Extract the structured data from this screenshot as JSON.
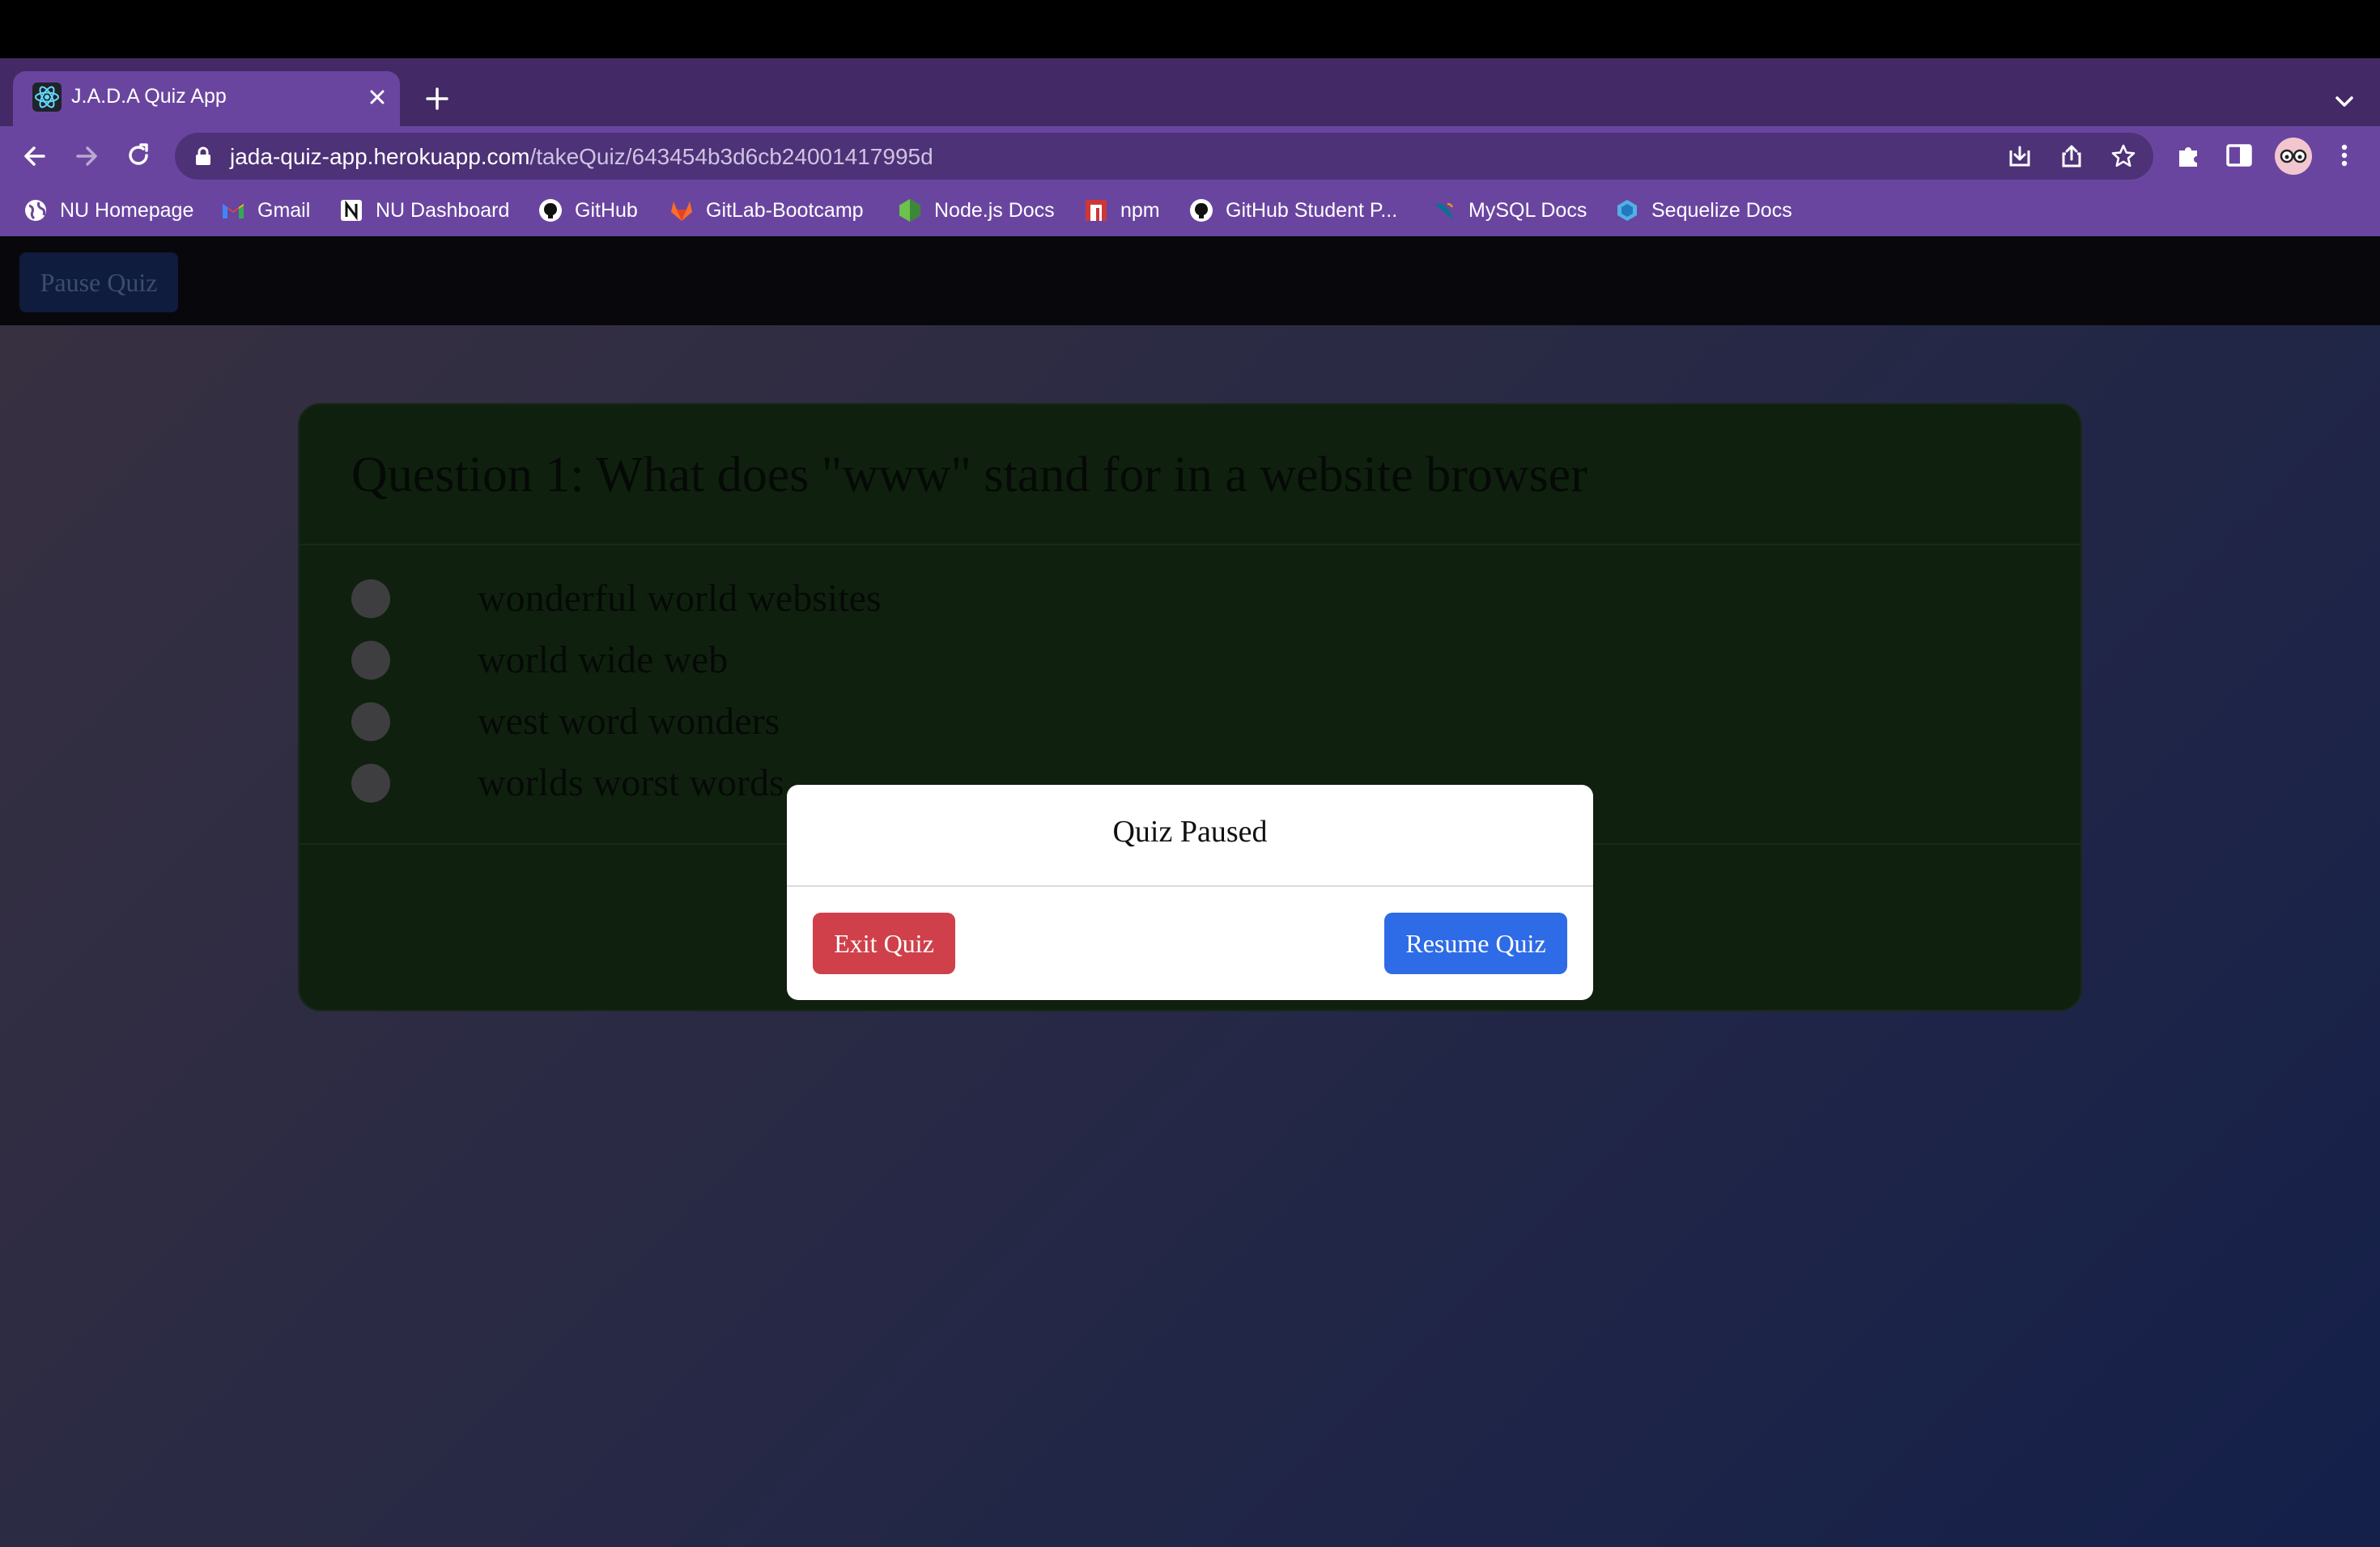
{
  "browser": {
    "tab_title": "J.A.D.A Quiz App",
    "url_host": "jada-quiz-app.herokuapp.com",
    "url_path": "/takeQuiz/643454b3d6cb24001417995d",
    "bookmarks": [
      {
        "label": "NU Homepage",
        "icon": "globe-icon"
      },
      {
        "label": "Gmail",
        "icon": "gmail-icon"
      },
      {
        "label": "NU Dashboard",
        "icon": "notion-icon"
      },
      {
        "label": "GitHub",
        "icon": "github-icon"
      },
      {
        "label": "GitLab-Bootcamp",
        "icon": "gitlab-icon"
      },
      {
        "label": "Node.js Docs",
        "icon": "nodejs-icon"
      },
      {
        "label": "npm",
        "icon": "npm-icon"
      },
      {
        "label": "GitHub Student P...",
        "icon": "github-icon"
      },
      {
        "label": "MySQL Docs",
        "icon": "mysql-icon"
      },
      {
        "label": "Sequelize Docs",
        "icon": "sequelize-icon"
      }
    ]
  },
  "app": {
    "pause_label": "Pause Quiz"
  },
  "quiz": {
    "question": "Question 1: What does \"www\" stand for in a website browser",
    "options": [
      "wonderful world websites",
      "world wide web",
      "west word wonders",
      "worlds worst words"
    ]
  },
  "modal": {
    "title": "Quiz Paused",
    "exit_label": "Exit Quiz",
    "resume_label": "Resume Quiz"
  },
  "colors": {
    "chrome": "#6a45a0",
    "exit_button": "#d0404a",
    "resume_button": "#2e6be6"
  }
}
